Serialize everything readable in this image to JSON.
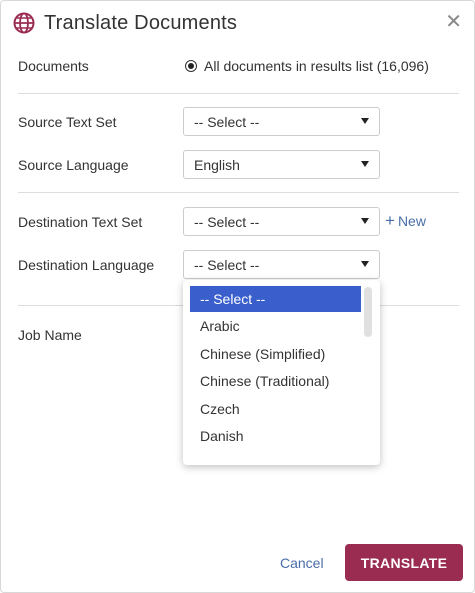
{
  "dialog": {
    "title": "Translate Documents",
    "close_glyph": "✕",
    "icon": "globe-icon"
  },
  "fields": {
    "documents_label": "Documents",
    "documents_option": "All documents in results list (16,096)",
    "source_text_set_label": "Source Text Set",
    "source_text_set_value": "-- Select --",
    "source_language_label": "Source Language",
    "source_language_value": "English",
    "destination_text_set_label": "Destination Text Set",
    "destination_text_set_value": "-- Select --",
    "new_link": "New",
    "destination_language_label": "Destination Language",
    "destination_language_value": "-- Select --",
    "job_name_label": "Job Name"
  },
  "dropdown": {
    "options": [
      "-- Select --",
      "Arabic",
      "Chinese (Simplified)",
      "Chinese (Traditional)",
      "Czech",
      "Danish"
    ],
    "selected_index": 0
  },
  "footer": {
    "cancel_label": "Cancel",
    "translate_label": "TRANSLATE"
  },
  "colors": {
    "accent": "#9b2c51",
    "link": "#4a6ea9",
    "selected_option": "#3a5fcd"
  }
}
